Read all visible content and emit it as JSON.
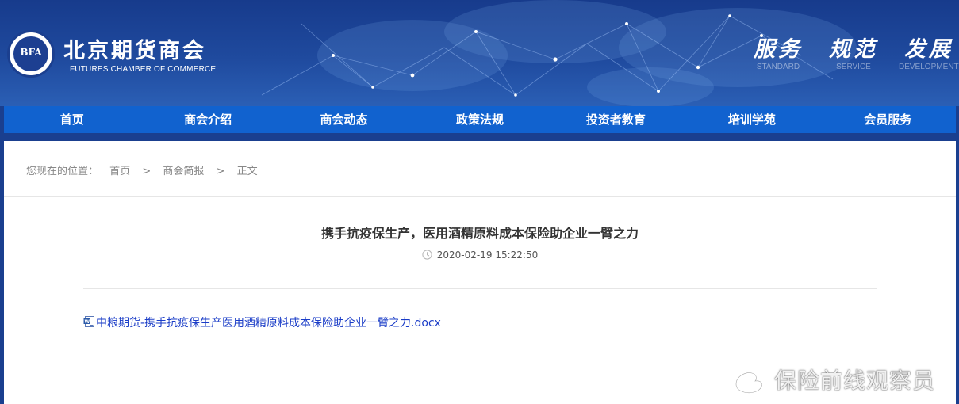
{
  "header": {
    "logo_abbr": "BFA",
    "brand_cn": "北京期货商会",
    "brand_en": "FUTURES CHAMBER OF COMMERCE",
    "slogans": [
      {
        "cn": "服务",
        "en": "STANDARD"
      },
      {
        "cn": "规范",
        "en": "SERVICE"
      },
      {
        "cn": "发展",
        "en": "DEVELOPMENT"
      }
    ]
  },
  "nav": {
    "items": [
      "首页",
      "商会介绍",
      "商会动态",
      "政策法规",
      "投资者教育",
      "培训学苑",
      "会员服务"
    ]
  },
  "breadcrumb": {
    "prefix": "您现在的位置：",
    "items": [
      "首页",
      "商会简报",
      "正文"
    ],
    "separator": ">"
  },
  "article": {
    "title": "携手抗疫保生产，医用酒精原料成本保险助企业一臂之力",
    "datetime": "2020-02-19 15:22:50",
    "attachment": "中粮期货-携手抗疫保生产医用酒精原料成本保险助企业一臂之力.docx"
  },
  "watermark": {
    "text": "保险前线观察员"
  },
  "colors": {
    "header_bg": "#1f4a9e",
    "nav_bg": "#1162cf",
    "link": "#1a3cc7"
  }
}
